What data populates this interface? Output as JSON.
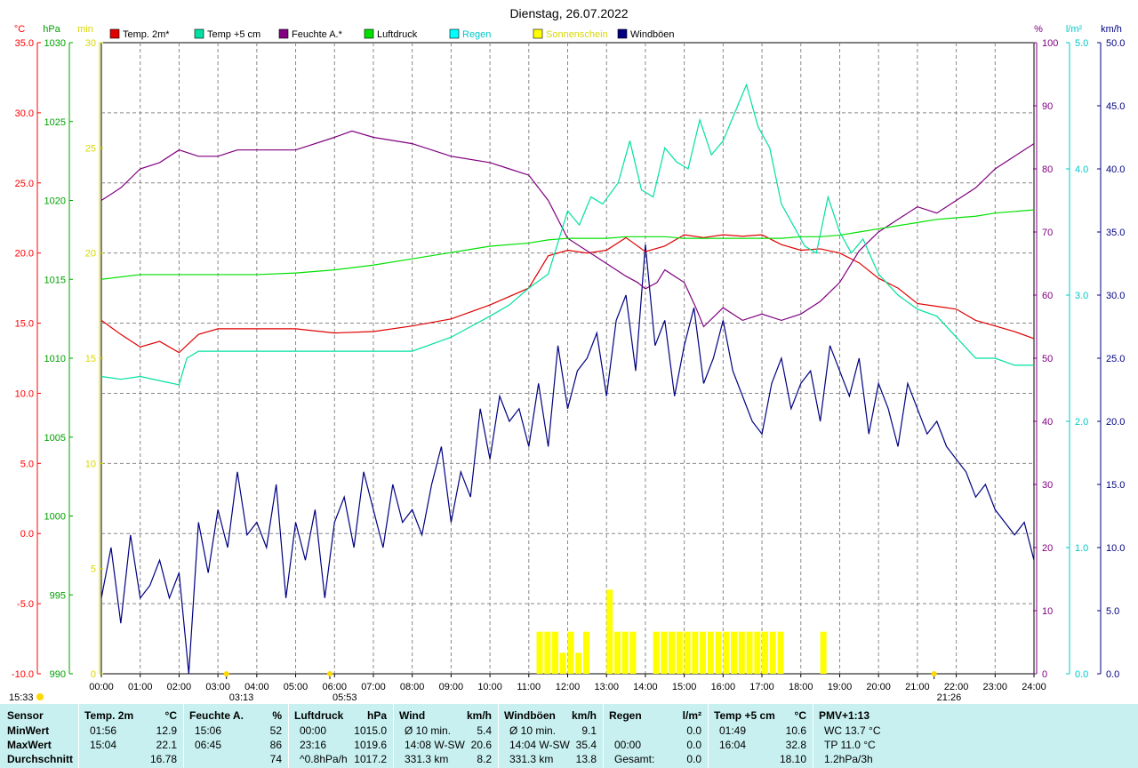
{
  "chart_data": {
    "type": "line",
    "title": "Dienstag, 26.07.2022",
    "x_ticks": [
      "00:00",
      "01:00",
      "02:00",
      "03:00",
      "04:00",
      "05:00",
      "06:00",
      "07:00",
      "08:00",
      "09:00",
      "10:00",
      "11:00",
      "12:00",
      "13:00",
      "14:00",
      "15:00",
      "16:00",
      "17:00",
      "18:00",
      "19:00",
      "20:00",
      "21:00",
      "22:00",
      "23:00",
      "24:00"
    ],
    "axes": {
      "temp": {
        "unit": "°C",
        "range": [
          -10,
          35
        ],
        "ticks": [
          "35.0",
          "30.0",
          "25.0",
          "20.0",
          "15.0",
          "10.0",
          "5.0",
          "0.0",
          "-5.0",
          "-10.0"
        ],
        "color": "#ff0000"
      },
      "pressure": {
        "unit": "hPa",
        "range": [
          990,
          1030
        ],
        "ticks": [
          "1030",
          "1025",
          "1020",
          "1015",
          "1010",
          "1005",
          "1000",
          "995",
          "990"
        ],
        "color": "#00cc00"
      },
      "sunshine": {
        "unit": "min",
        "range": [
          0,
          30
        ],
        "ticks": [
          "30",
          "25",
          "20",
          "15",
          "10",
          "5",
          "0"
        ],
        "color": "#ffff00"
      },
      "humidity": {
        "unit": "%",
        "range": [
          0,
          100
        ],
        "ticks": [
          "100",
          "90",
          "80",
          "70",
          "60",
          "50",
          "40",
          "30",
          "20",
          "10",
          "0"
        ],
        "color": "#800080"
      },
      "rain": {
        "unit": "l/m²",
        "range": [
          0,
          5
        ],
        "ticks": [
          "5.0",
          "4.0",
          "3.0",
          "2.0",
          "1.0",
          "0.0"
        ],
        "color": "#00ffff"
      },
      "wind": {
        "unit": "km/h",
        "range": [
          0,
          50
        ],
        "ticks": [
          "50.0",
          "45.0",
          "40.0",
          "35.0",
          "30.0",
          "25.0",
          "20.0",
          "15.0",
          "10.0",
          "5.0",
          "0.0"
        ],
        "color": "#000080"
      }
    },
    "legend": [
      {
        "name": "Temp. 2m*",
        "color": "#e00000"
      },
      {
        "name": "Temp +5 cm",
        "color": "#00e0a0"
      },
      {
        "name": "Feuchte A.*",
        "color": "#800080"
      },
      {
        "name": "Luftdruck",
        "color": "#00e000"
      },
      {
        "name": "Regen",
        "color": "#00ffff"
      },
      {
        "name": "Sonnenschein",
        "color": "#ffff00"
      },
      {
        "name": "Windböen",
        "color": "#000080"
      }
    ],
    "series": [
      {
        "name": "Temp. 2m*",
        "axis": "temp",
        "x": [
          0,
          0.5,
          1,
          1.5,
          2,
          2.5,
          3,
          4,
          5,
          6,
          7,
          8,
          9,
          10,
          11,
          11.5,
          12,
          12.5,
          13,
          13.5,
          14,
          14.5,
          15,
          15.5,
          16,
          16.5,
          17,
          17.5,
          18,
          18.5,
          19,
          19.5,
          20,
          20.5,
          21,
          21.5,
          22,
          22.5,
          23,
          23.5,
          24
        ],
        "values": [
          15.2,
          14.2,
          13.3,
          13.7,
          12.9,
          14.2,
          14.6,
          14.6,
          14.6,
          14.3,
          14.4,
          14.8,
          15.3,
          16.3,
          17.5,
          19.8,
          20.2,
          20.0,
          20.2,
          21.1,
          20.1,
          20.5,
          21.3,
          21.1,
          21.3,
          21.2,
          21.3,
          20.6,
          20.2,
          20.3,
          20.0,
          19.3,
          18.2,
          17.5,
          16.4,
          16.2,
          16.0,
          15.2,
          14.8,
          14.4,
          13.9
        ]
      },
      {
        "name": "Feuchte A.*",
        "axis": "humidity",
        "x": [
          0,
          0.5,
          1,
          1.5,
          2,
          2.5,
          3,
          3.5,
          4,
          5,
          6,
          6.45,
          7,
          8,
          9,
          10,
          10.5,
          11,
          11.5,
          12,
          12.5,
          13,
          13.5,
          13.8,
          14,
          14.3,
          14.5,
          15,
          15.3,
          15.5,
          16,
          16.5,
          17,
          17.5,
          18,
          18.5,
          19,
          19.5,
          20,
          20.5,
          21,
          21.5,
          22,
          22.5,
          23,
          23.5,
          24
        ],
        "values": [
          75,
          77,
          80,
          81,
          83,
          82,
          82,
          83,
          83,
          83,
          85,
          86,
          85,
          84,
          82,
          81,
          80,
          79,
          75,
          69,
          67,
          65,
          63,
          62,
          61,
          62,
          64,
          62,
          58,
          55,
          58,
          56,
          57,
          56,
          57,
          59,
          62,
          67,
          70,
          72,
          74,
          73,
          75,
          77,
          80,
          82,
          84
        ]
      },
      {
        "name": "Luftdruck",
        "axis": "pressure",
        "x": [
          0,
          1,
          2,
          3,
          4,
          5,
          6,
          7,
          8,
          9,
          10,
          11,
          11.5,
          12,
          12.5,
          13,
          13.5,
          14,
          14.5,
          15,
          15.5,
          16,
          16.5,
          17,
          17.5,
          18,
          18.5,
          19,
          19.5,
          20,
          20.5,
          21,
          21.5,
          22,
          22.5,
          23,
          23.5,
          24
        ],
        "values": [
          1015.0,
          1015.3,
          1015.3,
          1015.3,
          1015.3,
          1015.4,
          1015.6,
          1015.9,
          1016.3,
          1016.7,
          1017.1,
          1017.3,
          1017.5,
          1017.6,
          1017.6,
          1017.6,
          1017.7,
          1017.7,
          1017.7,
          1017.6,
          1017.6,
          1017.6,
          1017.6,
          1017.6,
          1017.6,
          1017.7,
          1017.7,
          1017.8,
          1018.0,
          1018.2,
          1018.4,
          1018.6,
          1018.8,
          1018.9,
          1019.0,
          1019.2,
          1019.3,
          1019.4
        ]
      },
      {
        "name": "Temp +5 cm",
        "axis": "temp",
        "x": [
          0,
          0.5,
          1,
          1.5,
          2,
          2.2,
          2.5,
          3,
          3.5,
          4,
          5,
          6,
          7,
          8,
          9,
          10,
          10.5,
          11,
          11.5,
          12,
          12.3,
          12.6,
          12.9,
          13.3,
          13.6,
          13.9,
          14.2,
          14.5,
          14.8,
          15.1,
          15.4,
          15.7,
          16.0,
          16.3,
          16.6,
          16.9,
          17.2,
          17.5,
          17.8,
          18.1,
          18.4,
          18.7,
          19.0,
          19.3,
          19.6,
          20,
          20.5,
          21,
          21.5,
          22,
          22.5,
          23,
          23.5,
          24
        ],
        "values": [
          11.2,
          11.0,
          11.2,
          10.9,
          10.6,
          12.5,
          13.0,
          13.0,
          13.0,
          13.0,
          13.0,
          13.0,
          13.0,
          13.0,
          14.0,
          15.5,
          16.3,
          17.5,
          18.5,
          23.0,
          22.0,
          24.0,
          23.5,
          25.0,
          28.0,
          24.5,
          24.0,
          27.5,
          26.5,
          26.0,
          29.5,
          27.0,
          28.0,
          30.0,
          32.0,
          29.0,
          27.5,
          23.5,
          22.0,
          20.5,
          20.0,
          24.0,
          21.5,
          20.0,
          21.0,
          18.5,
          17.0,
          16.0,
          15.5,
          14.0,
          12.5,
          12.5,
          12.0,
          12.0
        ]
      }
    ],
    "wind_gusts": {
      "name": "Windböen",
      "axis": "wind",
      "x": [
        0,
        0.25,
        0.5,
        0.75,
        1,
        1.25,
        1.5,
        1.75,
        2,
        2.25,
        2.5,
        2.75,
        3,
        3.25,
        3.5,
        3.75,
        4,
        4.25,
        4.5,
        4.75,
        5,
        5.25,
        5.5,
        5.75,
        6,
        6.25,
        6.5,
        6.75,
        7,
        7.25,
        7.5,
        7.75,
        8,
        8.25,
        8.5,
        8.75,
        9,
        9.25,
        9.5,
        9.75,
        10,
        10.25,
        10.5,
        10.75,
        11,
        11.25,
        11.5,
        11.75,
        12,
        12.25,
        12.5,
        12.75,
        13,
        13.25,
        13.5,
        13.75,
        14,
        14.25,
        14.5,
        14.75,
        15,
        15.25,
        15.5,
        15.75,
        16,
        16.25,
        16.5,
        16.75,
        17,
        17.25,
        17.5,
        17.75,
        18,
        18.25,
        18.5,
        18.75,
        19,
        19.25,
        19.5,
        19.75,
        20,
        20.25,
        20.5,
        20.75,
        21,
        21.25,
        21.5,
        21.75,
        22,
        22.25,
        22.5,
        22.75,
        23,
        23.25,
        23.5,
        23.75,
        24
      ],
      "values": [
        6,
        10,
        4,
        11,
        6,
        7,
        9,
        6,
        8,
        0,
        12,
        8,
        13,
        10,
        16,
        11,
        12,
        10,
        15,
        6,
        12,
        9,
        13,
        6,
        12,
        14,
        10,
        16,
        13,
        10,
        15,
        12,
        13,
        11,
        15,
        18,
        12,
        16,
        14,
        21,
        17,
        22,
        20,
        21,
        18,
        23,
        18,
        26,
        21,
        24,
        25,
        27,
        22,
        28,
        30,
        24,
        34,
        26,
        28,
        22,
        26,
        29,
        23,
        25,
        28,
        24,
        22,
        20,
        19,
        23,
        25,
        21,
        23,
        24,
        20,
        26,
        24,
        22,
        25,
        19,
        23,
        21,
        18,
        23,
        21,
        19,
        20,
        18,
        17,
        16,
        14,
        15,
        13,
        12,
        11,
        12,
        9,
        13,
        11
      ]
    },
    "sunshine": {
      "name": "Sonnenschein",
      "axis": "sunshine",
      "x": [
        11.2,
        11.4,
        11.6,
        11.8,
        12.0,
        12.2,
        12.4,
        13.0,
        13.2,
        13.4,
        13.6,
        14.2,
        14.4,
        14.6,
        14.8,
        15.0,
        15.2,
        15.4,
        15.6,
        15.8,
        16.0,
        16.2,
        16.4,
        16.6,
        16.8,
        17.0,
        17.2,
        17.4,
        18.5
      ],
      "values": [
        2,
        2,
        2,
        1,
        2,
        1,
        2,
        4,
        2,
        2,
        2,
        2,
        2,
        2,
        2,
        2,
        2,
        2,
        2,
        2,
        2,
        2,
        2,
        2,
        2,
        2,
        2,
        2,
        2
      ]
    },
    "markers": [
      {
        "label": "03:13",
        "x": 3.22,
        "kind": "moon"
      },
      {
        "label": "05:53",
        "x": 5.88,
        "kind": "sunrise"
      },
      {
        "label": "21:26",
        "x": 21.43,
        "kind": "sunset"
      },
      {
        "label": "15:33",
        "x": null,
        "kind": "moon-left"
      }
    ]
  },
  "table": {
    "row_labels": [
      "Sensor",
      "MinWert",
      "MaxWert",
      "Durchschnitt"
    ],
    "columns": [
      {
        "title": "Temp. 2m",
        "unit": "°C",
        "rows": [
          [
            "01:56",
            "12.9"
          ],
          [
            "15:04",
            "22.1"
          ],
          [
            "",
            "16.78"
          ]
        ]
      },
      {
        "title": "Feuchte A.",
        "unit": "%",
        "rows": [
          [
            "15:06",
            "52"
          ],
          [
            "06:45",
            "86"
          ],
          [
            "",
            "74"
          ]
        ]
      },
      {
        "title": "Luftdruck",
        "unit": "hPa",
        "rows": [
          [
            "00:00",
            "1015.0"
          ],
          [
            "23:16",
            "1019.6"
          ],
          [
            "^0.8hPa/h",
            "1017.2"
          ]
        ]
      },
      {
        "title": "Wind",
        "unit": "km/h",
        "rows": [
          [
            "Ø 10 min.",
            "5.4"
          ],
          [
            "14:08   W-SW",
            "20.6"
          ],
          [
            "331.3 km",
            "8.2"
          ]
        ]
      },
      {
        "title": "Windböen",
        "unit": "km/h",
        "rows": [
          [
            "Ø 10 min.",
            "9.1"
          ],
          [
            "14:04   W-SW",
            "35.4"
          ],
          [
            "331.3 km",
            "13.8"
          ]
        ]
      },
      {
        "title": "Regen",
        "unit": "l/m²",
        "rows": [
          [
            "",
            ""
          ],
          [
            "00:00",
            "0.0"
          ],
          [
            "Gesamt:",
            "0.0"
          ]
        ],
        "extra": "0.0"
      },
      {
        "title": "Temp +5 cm",
        "unit": "°C",
        "rows": [
          [
            "01:49",
            "10.6"
          ],
          [
            "16:04",
            "32.8"
          ],
          [
            "",
            "18.10"
          ]
        ]
      },
      {
        "title": "PMV+1:13",
        "unit": "",
        "rows": [
          [
            "WC 13.7 °C",
            ""
          ],
          [
            "TP 11.0 °C",
            ""
          ],
          [
            "1.2hPa/3h",
            ""
          ]
        ]
      }
    ]
  }
}
